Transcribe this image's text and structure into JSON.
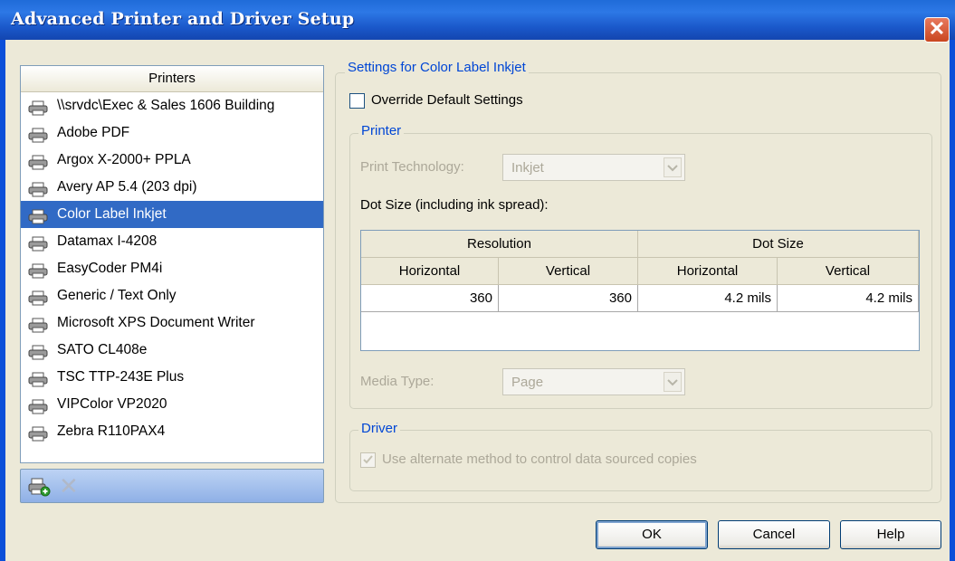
{
  "window": {
    "title": "Advanced Printer and Driver Setup",
    "close_glyph": "✕"
  },
  "printers": {
    "header": "Printers",
    "selected": "Color Label Inkjet",
    "items": [
      "\\\\srvdc\\Exec & Sales 1606 Building",
      "Adobe PDF",
      "Argox X-2000+ PPLA",
      "Avery AP 5.4 (203 dpi)",
      "Color Label Inkjet",
      "Datamax I-4208",
      "EasyCoder PM4i",
      "Generic / Text Only",
      "Microsoft XPS Document Writer",
      "SATO CL408e",
      "TSC TTP-243E Plus",
      "VIPColor VP2020",
      "Zebra R110PAX4"
    ],
    "toolbar_icons": [
      "add-printer-icon",
      "delete-icon"
    ]
  },
  "settings": {
    "legend": "Settings for Color Label Inkjet",
    "override_label": "Override Default Settings",
    "override_checked": false,
    "printer_group": {
      "legend": "Printer",
      "print_technology_label": "Print Technology:",
      "print_technology_value": "Inkjet",
      "dot_size_label": "Dot Size (including ink spread):",
      "grid": {
        "group_headers": [
          "Resolution",
          "Dot Size"
        ],
        "columns": [
          "Horizontal",
          "Vertical",
          "Horizontal",
          "Vertical"
        ],
        "row": [
          "360",
          "360",
          "4.2 mils",
          "4.2 mils"
        ]
      },
      "media_type_label": "Media Type:",
      "media_type_value": "Page"
    },
    "driver_group": {
      "legend": "Driver",
      "alternate_label": "Use alternate method to control data sourced copies",
      "alternate_checked": true
    }
  },
  "buttons": {
    "ok": "OK",
    "cancel": "Cancel",
    "help": "Help"
  },
  "colors": {
    "titlebar": "#1f6bd8",
    "selection": "#316ac5",
    "group_legend": "#0046d5"
  }
}
